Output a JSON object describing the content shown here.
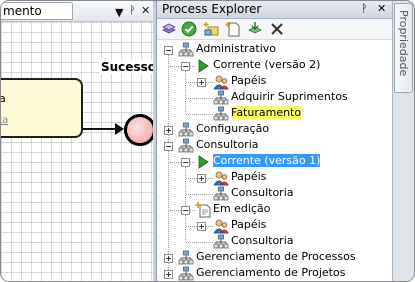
{
  "document": {
    "tab_label": "mento",
    "menu_icon": "▼",
    "pin_icon": "ᚹ",
    "close_icon": "✕",
    "canvas": {
      "event_label": "Sucesso",
      "task_text": "ça",
      "task_link": "sta"
    }
  },
  "explorer": {
    "title": "Process Explorer",
    "pin_icon": "ᚹ",
    "close_icon": "✕",
    "toolbar": [
      "book-stack-icon",
      "check-circle-icon",
      "new-folder-icon",
      "new-document-icon",
      "export-icon",
      "delete-icon"
    ],
    "tree": [
      {
        "label": "Administrativo",
        "expanded": true
      },
      {
        "label": "Corrente (versão 2)",
        "expanded": true
      },
      {
        "label": "Papéis",
        "expanded": false
      },
      {
        "label": "Adquirir Suprimentos"
      },
      {
        "label": "Faturamento",
        "highlight": "yellow"
      },
      {
        "label": "Configuração",
        "expanded": false
      },
      {
        "label": "Consultoria",
        "expanded": true
      },
      {
        "label": "Corrente (versão 1)",
        "expanded": true,
        "highlight": "selected"
      },
      {
        "label": "Papéis",
        "expanded": false
      },
      {
        "label": "Consultoria"
      },
      {
        "label": "Em edição",
        "expanded": true
      },
      {
        "label": "Papéis",
        "expanded": false
      },
      {
        "label": "Consultoria"
      },
      {
        "label": "Gerenciamento de Processos",
        "expanded": false
      },
      {
        "label": "Gerenciamento de Projetos",
        "expanded": false
      }
    ]
  },
  "side_panel": {
    "tab_label": "Propriedade"
  },
  "colors": {
    "selection": "#3399ff",
    "highlight": "#ffff66",
    "task_fill": "#fffbd6",
    "end_event_fill": "#f09a9a"
  }
}
